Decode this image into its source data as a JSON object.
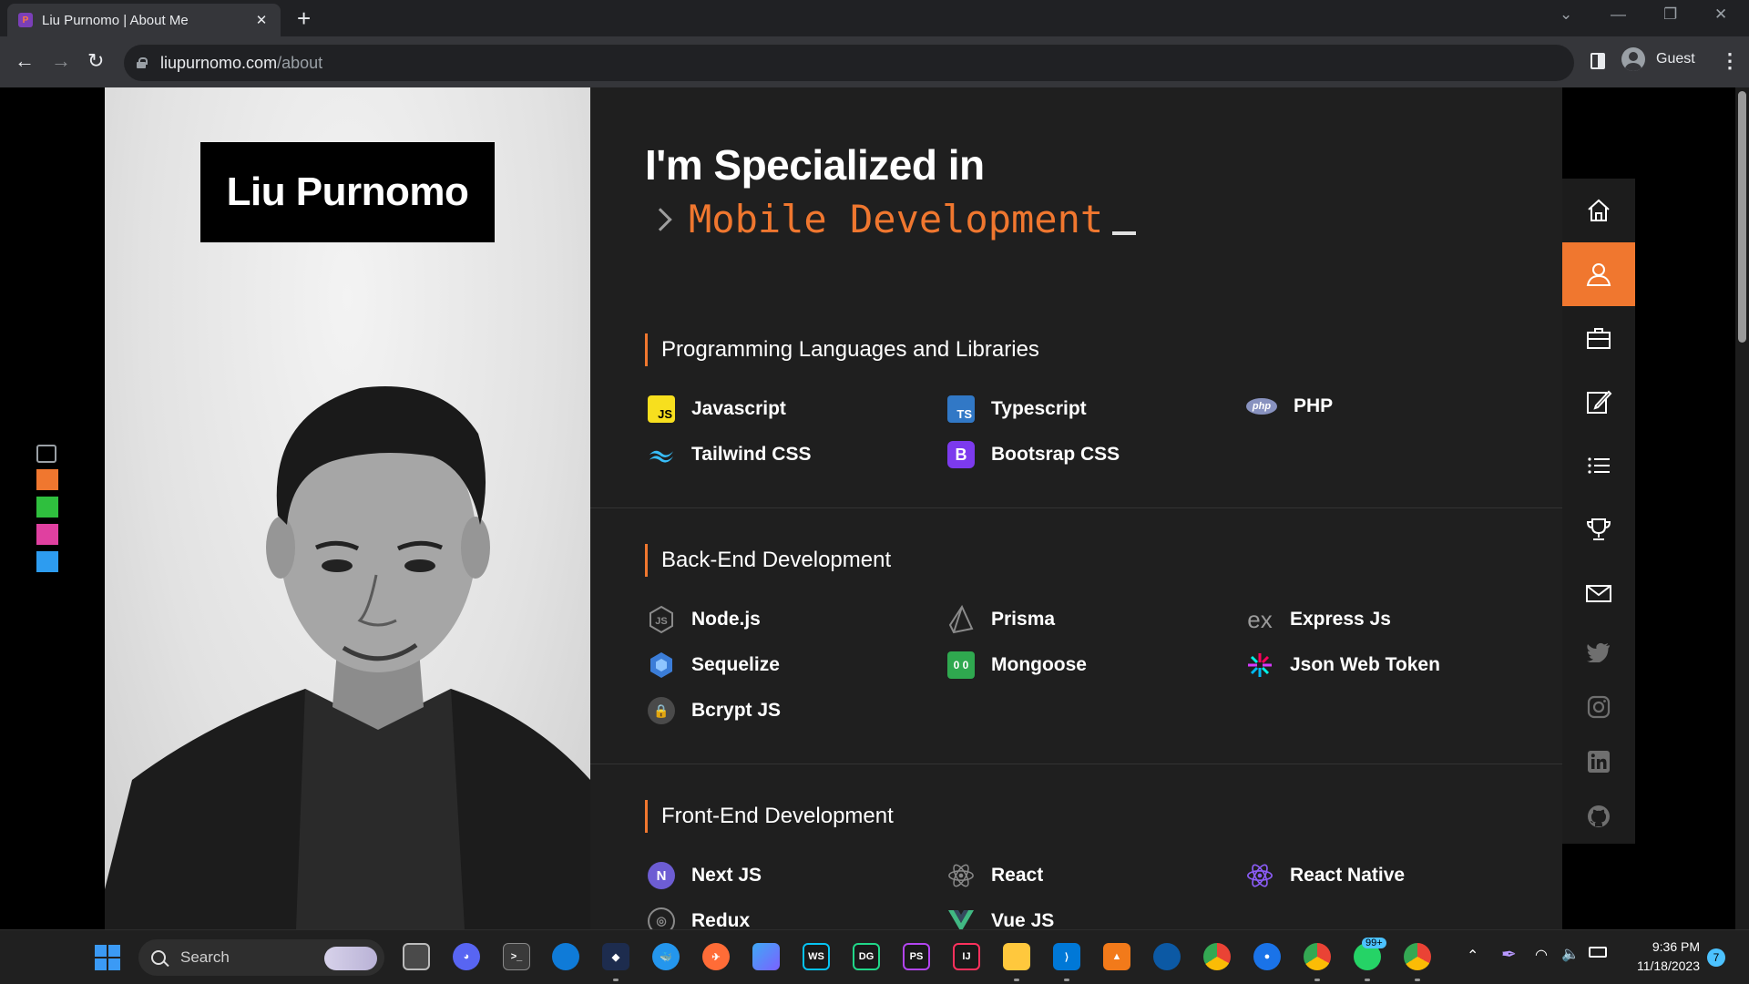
{
  "browser": {
    "tab_title": "Liu Purnomo | About Me",
    "tab_close": "✕",
    "new_tab": "+",
    "url_host": "liupurnomo.com",
    "url_path": "/about",
    "profile_name": "Guest",
    "back": "←",
    "forward": "→",
    "reload": "↻",
    "menu": "⋮",
    "minimize": "—",
    "restore": "❐",
    "close": "✕",
    "tab_list": "⌄"
  },
  "page": {
    "name": "Liu Purnomo",
    "heading": "I'm Specialized in",
    "typed_text": "Mobile Development",
    "theme_swatches": [
      "#f0772f",
      "#2fbf3e",
      "#e040a0",
      "#2d9cf0"
    ],
    "sections": [
      {
        "title": "Programming Languages and Libraries",
        "skills": [
          {
            "label": "Javascript",
            "icon": "javascript-icon"
          },
          {
            "label": "Typescript",
            "icon": "typescript-icon"
          },
          {
            "label": "PHP",
            "icon": "php-icon"
          },
          {
            "label": "Tailwind CSS",
            "icon": "tailwind-icon"
          },
          {
            "label": "Bootsrap CSS",
            "icon": "bootstrap-icon"
          }
        ]
      },
      {
        "title": "Back-End Development",
        "skills": [
          {
            "label": "Node.js",
            "icon": "nodejs-icon"
          },
          {
            "label": "Prisma",
            "icon": "prisma-icon"
          },
          {
            "label": "Express Js",
            "icon": "express-icon"
          },
          {
            "label": "Sequelize",
            "icon": "sequelize-icon"
          },
          {
            "label": "Mongoose",
            "icon": "mongoose-icon"
          },
          {
            "label": "Json Web Token",
            "icon": "jwt-icon"
          },
          {
            "label": "Bcrypt JS",
            "icon": "bcrypt-icon"
          }
        ]
      },
      {
        "title": "Front-End Development",
        "skills": [
          {
            "label": "Next JS",
            "icon": "nextjs-icon"
          },
          {
            "label": "React",
            "icon": "react-icon"
          },
          {
            "label": "React Native",
            "icon": "react-native-icon"
          },
          {
            "label": "Redux",
            "icon": "redux-icon"
          },
          {
            "label": "Vue JS",
            "icon": "vuejs-icon"
          }
        ]
      }
    ],
    "nav": [
      {
        "icon": "home-icon",
        "active": false
      },
      {
        "icon": "user-icon",
        "active": true
      },
      {
        "icon": "briefcase-icon",
        "active": false
      },
      {
        "icon": "edit-icon",
        "active": false
      },
      {
        "icon": "list-icon",
        "active": false
      },
      {
        "icon": "trophy-icon",
        "active": false
      },
      {
        "icon": "mail-icon",
        "active": false
      }
    ],
    "social": [
      "twitter-icon",
      "instagram-icon",
      "linkedin-icon",
      "github-icon"
    ]
  },
  "taskbar": {
    "search_label": "Search",
    "time": "9:36 PM",
    "date": "11/18/2023",
    "whatsapp_badge": "99+",
    "notifications": "7",
    "apps": [
      "start-icon",
      "task-view-icon",
      "discord-icon",
      "terminal-icon",
      "edge-dev-icon",
      "sourcetree-icon",
      "docker-icon",
      "postman-icon",
      "notes-icon",
      "webstorm-icon",
      "datagrip-icon",
      "phpstorm-icon",
      "intellij-icon",
      "file-explorer-icon",
      "vscode-icon",
      "app-icon",
      "edge-icon",
      "chrome-icon",
      "maps-icon",
      "chrome-profile-icon",
      "whatsapp-icon",
      "chrome-guest-icon"
    ]
  }
}
